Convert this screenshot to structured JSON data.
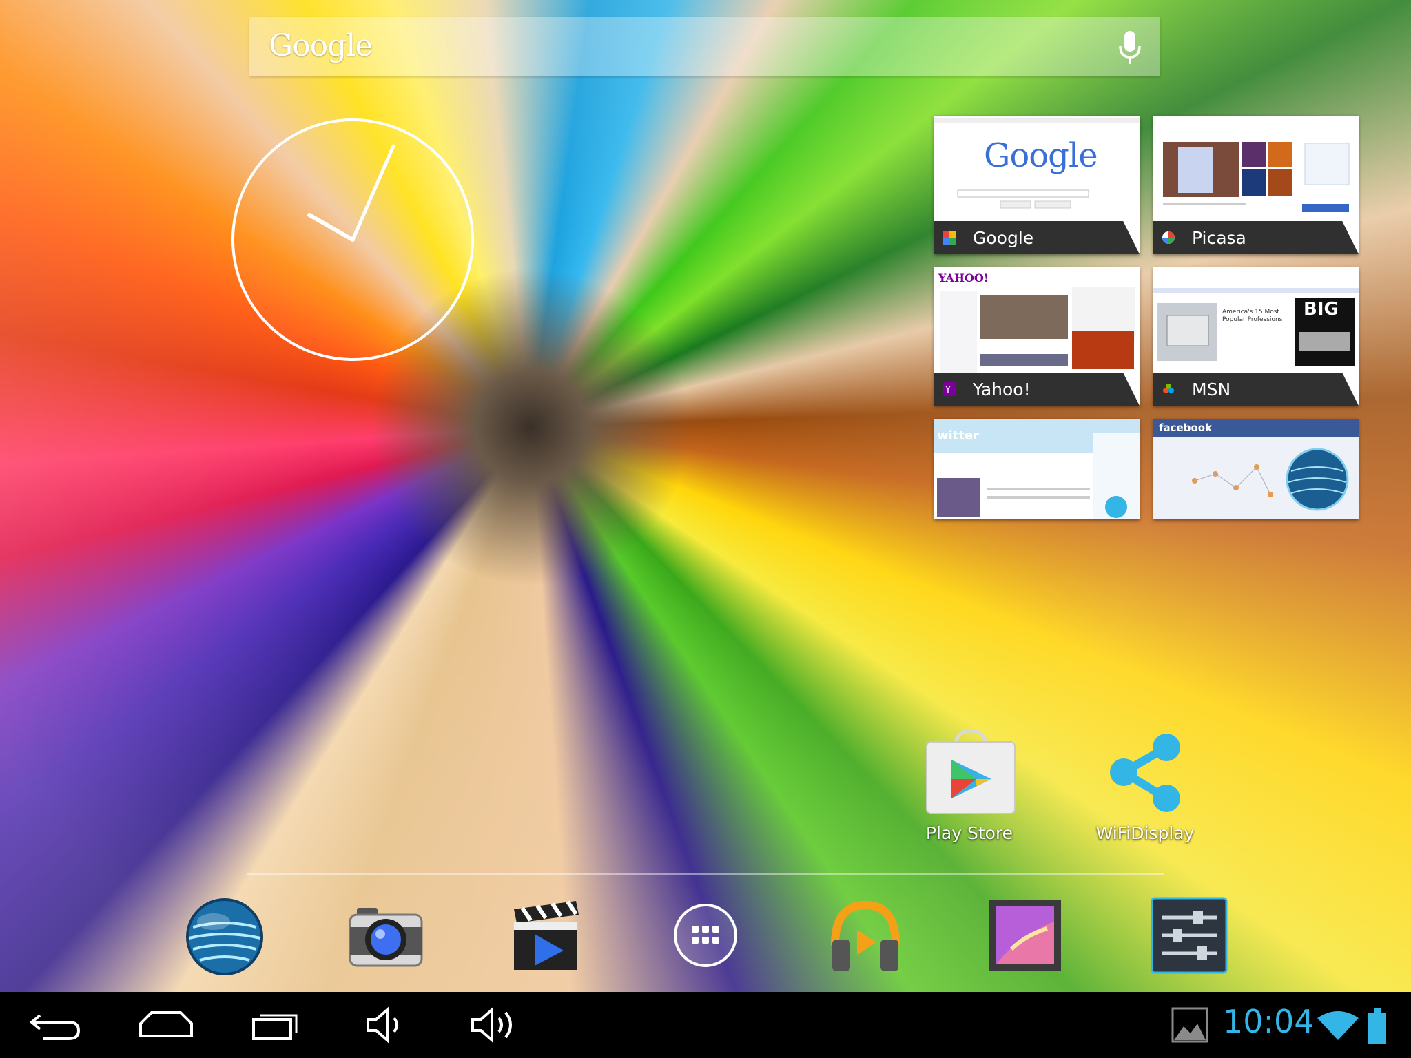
{
  "search": {
    "logo_text": "Google"
  },
  "clock": {
    "hour": 10,
    "minute": 4
  },
  "bookmarks": [
    {
      "title": "Google"
    },
    {
      "title": "Picasa"
    },
    {
      "title": "Yahoo!"
    },
    {
      "title": "MSN"
    },
    {
      "title": ""
    },
    {
      "title": ""
    }
  ],
  "thumbs": {
    "google_logo": "Google",
    "twitter_logo": "witter",
    "facebook_logo": "facebook",
    "yahoo_logo": "YAHOO!",
    "msn_headline": "America's 15 Most Popular Professions",
    "msn_big": "BIG"
  },
  "home_apps": [
    {
      "label": "Play Store",
      "icon": "play-store-icon"
    },
    {
      "label": "WiFiDisplay",
      "icon": "share-icon"
    }
  ],
  "dock": [
    {
      "name": "browser",
      "icon": "globe-icon"
    },
    {
      "name": "camera",
      "icon": "camera-icon"
    },
    {
      "name": "video",
      "icon": "video-player-icon"
    },
    {
      "name": "apps",
      "icon": "all-apps-icon"
    },
    {
      "name": "music",
      "icon": "headphones-icon"
    },
    {
      "name": "gallery",
      "icon": "gallery-icon"
    },
    {
      "name": "settings",
      "icon": "settings-sliders-icon"
    }
  ],
  "status": {
    "time": "10:04"
  },
  "colors": {
    "accent": "#33b5e5",
    "navbar": "#000000"
  }
}
